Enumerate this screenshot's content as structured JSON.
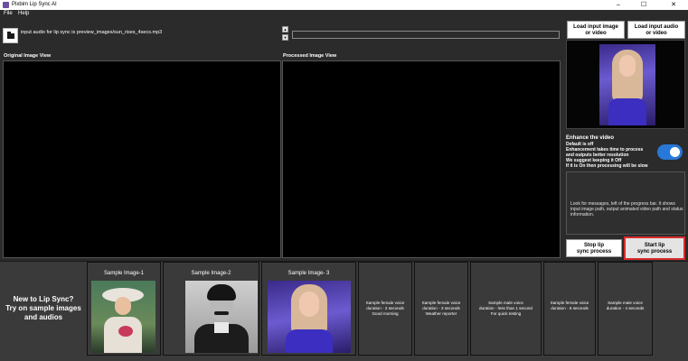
{
  "window": {
    "title": "Pixbim Lip Sync AI",
    "controls": [
      "–",
      "☐",
      "✕"
    ]
  },
  "menu": {
    "items": [
      "File",
      "Help"
    ]
  },
  "toolbar": {
    "path_text": "input audio for lip sync is preview_images/sun_rises_4secs.mp3",
    "spin_up": "▲",
    "spin_down": "▼"
  },
  "views": {
    "original_label": "Original Image View",
    "processed_label": "Processed Image View"
  },
  "right_panel": {
    "load_image_label": [
      "Load input image",
      "or video"
    ],
    "load_audio_label": [
      "Load input audio",
      "or video"
    ],
    "enhance_title": "Enhance the video",
    "enhance_lines": [
      "Default is off",
      "Enhancement takes time to process",
      "and outputs better resolution",
      "We suggest keeping it Off",
      "If it is On then processing will be slow"
    ],
    "enhance_toggle_on": true,
    "messages_text": "Look for messages, left of the progress bar. It shows input image path, output animated video path and status information.",
    "stop_label": [
      "Stop lip",
      "sync process"
    ],
    "start_label": [
      "Start lip",
      "sync process"
    ]
  },
  "bottom": {
    "intro_lines": [
      "New to Lip Sync?",
      "Try on sample images",
      "and audios"
    ],
    "sample_images": [
      {
        "title": "Sample Image-1",
        "icon": "victorian-woman-portrait"
      },
      {
        "title": "Sample Image-2",
        "icon": "bw-man-portrait"
      },
      {
        "title": "Sample Image- 3",
        "icon": "blonde-woman-portrait"
      }
    ],
    "sample_audios": [
      {
        "lines": [
          "Sample female voice",
          "duration - 2 seconds",
          "Good morning"
        ]
      },
      {
        "lines": [
          "Sample female voice",
          "duration - 3 seconds",
          "Weather reporter"
        ]
      },
      {
        "lines": [
          "Sample male voice",
          "duration - less than 1 second",
          "For quick testing"
        ]
      },
      {
        "lines": [
          "Sample female voice",
          "duration - 6 seconds"
        ]
      },
      {
        "lines": [
          "Sample male voice",
          "duration - 4 seconds"
        ]
      }
    ]
  },
  "colors": {
    "background": "#2b2b2b",
    "toggle_on": "#2878d8",
    "highlight_border": "#d82c2c"
  }
}
